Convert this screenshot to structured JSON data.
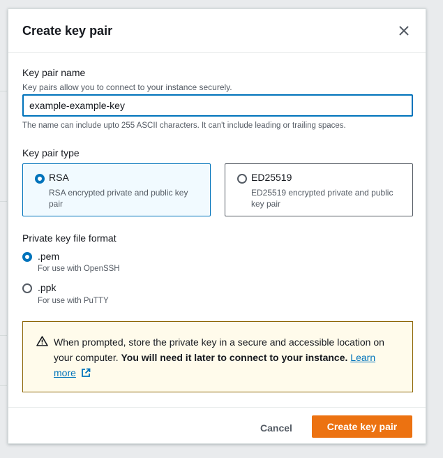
{
  "dialog": {
    "title": "Create key pair",
    "close_icon": "close-icon"
  },
  "key_name": {
    "label": "Key pair name",
    "description": "Key pairs allow you to connect to your instance securely.",
    "value": "example-example-key",
    "constraint": "The name can include upto 255 ASCII characters. It can't include leading or trailing spaces."
  },
  "key_type": {
    "label": "Key pair type",
    "options": [
      {
        "title": "RSA",
        "description": "RSA encrypted private and public key pair",
        "selected": true
      },
      {
        "title": "ED25519",
        "description": "ED25519 encrypted private and public key pair",
        "selected": false
      }
    ]
  },
  "file_format": {
    "label": "Private key file format",
    "options": [
      {
        "title": ".pem",
        "description": "For use with OpenSSH",
        "selected": true
      },
      {
        "title": ".ppk",
        "description": "For use with PuTTY",
        "selected": false
      }
    ]
  },
  "warning": {
    "icon": "warning-icon",
    "text": "When prompted, store the private key in a secure and accessible location on your computer.",
    "bold_text": "You will need it later to connect to your instance.",
    "link_text_1": "Learn",
    "link_text_2": "more",
    "link_icon": "external-link-icon"
  },
  "footer": {
    "cancel_label": "Cancel",
    "submit_label": "Create key pair"
  },
  "colors": {
    "accent": "#0073bb",
    "primary_button": "#ec7211",
    "warning_bg": "#fffbeb",
    "warning_border": "#8d6605"
  }
}
